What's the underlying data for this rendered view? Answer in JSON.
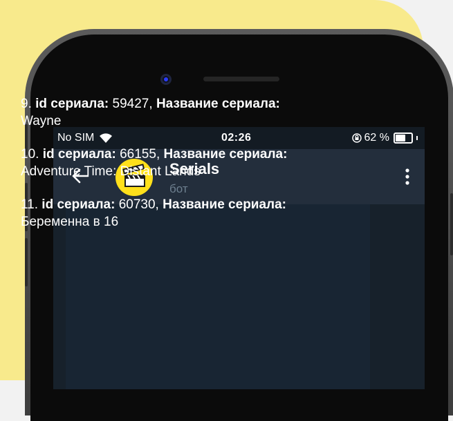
{
  "status_bar": {
    "carrier": "No SIM",
    "time": "02:26",
    "battery": "62 %",
    "battery_level": 0.62,
    "icons": [
      "wifi-icon",
      "rotation-lock-icon",
      "battery-icon"
    ]
  },
  "header": {
    "title": "Serials",
    "subtitle": "бот",
    "avatar_icon": "clapperboard-icon",
    "avatar_color": "#ffe01b"
  },
  "messages": [
    {
      "num": "9.",
      "id_label": "id сериала:",
      "id_value": " 59427, ",
      "name_label": "Название сериала:",
      "name_value": " Wayne"
    },
    {
      "num": "10.",
      "id_label": "id сериала:",
      "id_value": " 66155, ",
      "name_label": "Название сериала:",
      "name_value": " Adventure Time: Distant Lands"
    },
    {
      "num": "11.",
      "id_label": "id сериала:",
      "id_value": " 60730, ",
      "name_label": "Название сериала:",
      "name_value": " Беременна в 16"
    }
  ],
  "colors": {
    "background_accent": "#f8ea8c",
    "chat_background": "#17212b",
    "header_background": "#232e3c",
    "bubble_background": "#182533"
  }
}
